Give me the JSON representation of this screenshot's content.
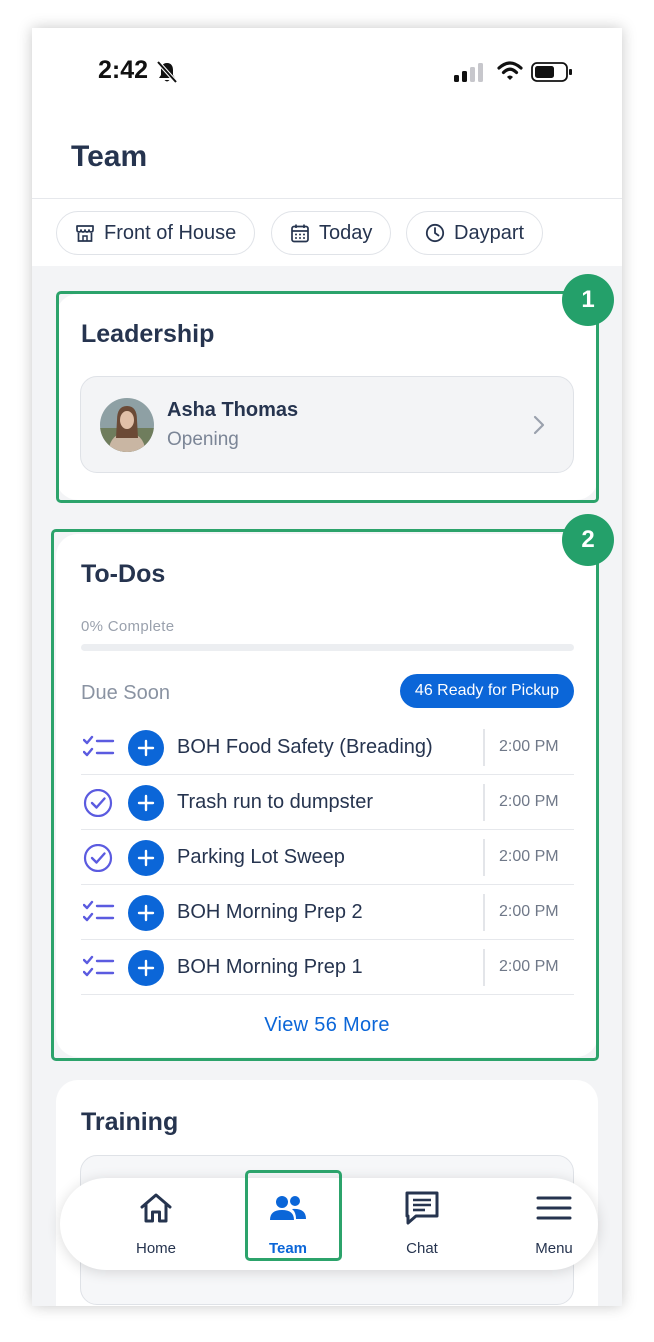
{
  "status_bar": {
    "time": "2:42"
  },
  "header": {
    "title": "Team"
  },
  "filters": [
    {
      "label": "Front of House",
      "icon": "store-icon"
    },
    {
      "label": "Today",
      "icon": "calendar-icon"
    },
    {
      "label": "Daypart",
      "icon": "clock-icon"
    }
  ],
  "annotations": {
    "first": "1",
    "second": "2"
  },
  "leadership": {
    "title": "Leadership",
    "person": {
      "name": "Asha Thomas",
      "role": "Opening"
    }
  },
  "todos": {
    "title": "To-Dos",
    "progress_text": "0% Complete",
    "progress": 0,
    "due_label": "Due Soon",
    "pickup_badge": "46 Ready for Pickup",
    "items": [
      {
        "label": "BOH Food Safety (Breading)",
        "time": "2:00 PM",
        "icon": "checklist-icon"
      },
      {
        "label": "Trash run to dumpster",
        "time": "2:00 PM",
        "icon": "check-circle-icon"
      },
      {
        "label": "Parking Lot Sweep",
        "time": "2:00 PM",
        "icon": "check-circle-icon"
      },
      {
        "label": "BOH Morning Prep 2",
        "time": "2:00 PM",
        "icon": "checklist-icon"
      },
      {
        "label": "BOH Morning Prep 1",
        "time": "2:00 PM",
        "icon": "checklist-icon"
      }
    ],
    "view_more": "View 56 More"
  },
  "training": {
    "title": "Training"
  },
  "nav": [
    {
      "label": "Home",
      "icon": "home-icon"
    },
    {
      "label": "Team",
      "icon": "team-icon",
      "active": true
    },
    {
      "label": "Chat",
      "icon": "chat-icon"
    },
    {
      "label": "Menu",
      "icon": "menu-icon"
    }
  ],
  "colors": {
    "accent": "#0b66d8",
    "annotation": "#2ca36b",
    "text": "#26344f"
  }
}
